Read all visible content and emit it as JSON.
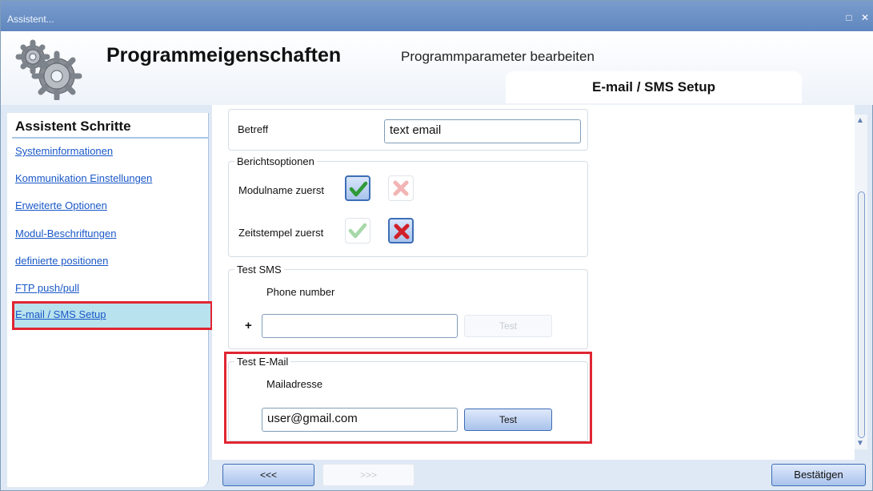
{
  "window": {
    "title": "Assistent..."
  },
  "header": {
    "title": "Programmeigenschaften",
    "subtitle": "Programmparameter bearbeiten",
    "tab_label": "E-mail / SMS Setup"
  },
  "sidebar": {
    "title": "Assistent Schritte",
    "items": [
      {
        "label": "Systeminformationen"
      },
      {
        "label": "Kommunikation Einstellungen"
      },
      {
        "label": "Erweiterte Optionen"
      },
      {
        "label": "Modul-Beschriftungen"
      },
      {
        "label": "definierte positionen"
      },
      {
        "label": "FTP push/pull"
      },
      {
        "label": "E-mail / SMS Setup",
        "selected": true
      }
    ]
  },
  "form": {
    "betreff": {
      "label": "Betreff",
      "value": "text email"
    },
    "berichtsoptionen": {
      "legend": "Berichtsoptionen",
      "rows": [
        {
          "label": "Modulname zuerst",
          "selected": "check"
        },
        {
          "label": "Zeitstempel zuerst",
          "selected": "cross"
        }
      ]
    },
    "test_sms": {
      "legend": "Test SMS",
      "phone_label": "Phone number",
      "prefix": "+",
      "value": "",
      "button": "Test",
      "button_enabled": false
    },
    "test_email": {
      "legend": "Test E-Mail",
      "mail_label": "Mailadresse",
      "value": "user@gmail.com",
      "button": "Test",
      "button_enabled": true
    }
  },
  "footer": {
    "prev_button": "<<<",
    "next_button": ">>>",
    "confirm_button": "Bestätigen"
  },
  "colors": {
    "highlight": "#e02632",
    "accent": "#3d6db6",
    "link": "#1a58c8"
  }
}
